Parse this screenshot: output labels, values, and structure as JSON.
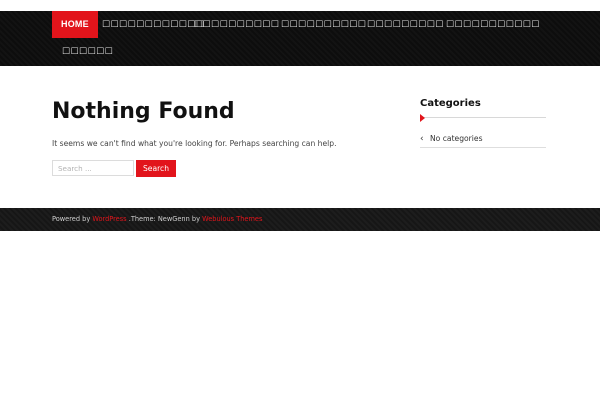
{
  "nav": {
    "items": [
      {
        "label": "HOME",
        "active": true
      },
      {
        "label": "□□□□□□□□□□□□",
        "active": false
      },
      {
        "label": "□□□□□□□□□□",
        "active": false
      },
      {
        "label": "□□□□□□□□□□",
        "active": false
      },
      {
        "label": "□□□□□□□□□",
        "active": false
      },
      {
        "label": "□□□□□□□□□□□",
        "active": false
      },
      {
        "label": "□□□□□□",
        "active": false
      }
    ]
  },
  "content": {
    "title": "Nothing Found",
    "notice": "It seems we can't find what you're looking for. Perhaps searching can help.",
    "search": {
      "placeholder": "Search ...",
      "button_label": "Search"
    }
  },
  "sidebar": {
    "widget_title": "Categories",
    "items": [
      {
        "label": "No categories",
        "icon": "chevron-left-icon"
      }
    ]
  },
  "footer": {
    "prefix": "Powered by ",
    "wordpress_link": "WordPress",
    "theme_text": " .Theme: NewGenn by ",
    "author_link": "Webulous Themes"
  },
  "colors": {
    "accent": "#e2141b",
    "nav_bg": "#0d0d0d",
    "footer_bg": "#161616"
  }
}
